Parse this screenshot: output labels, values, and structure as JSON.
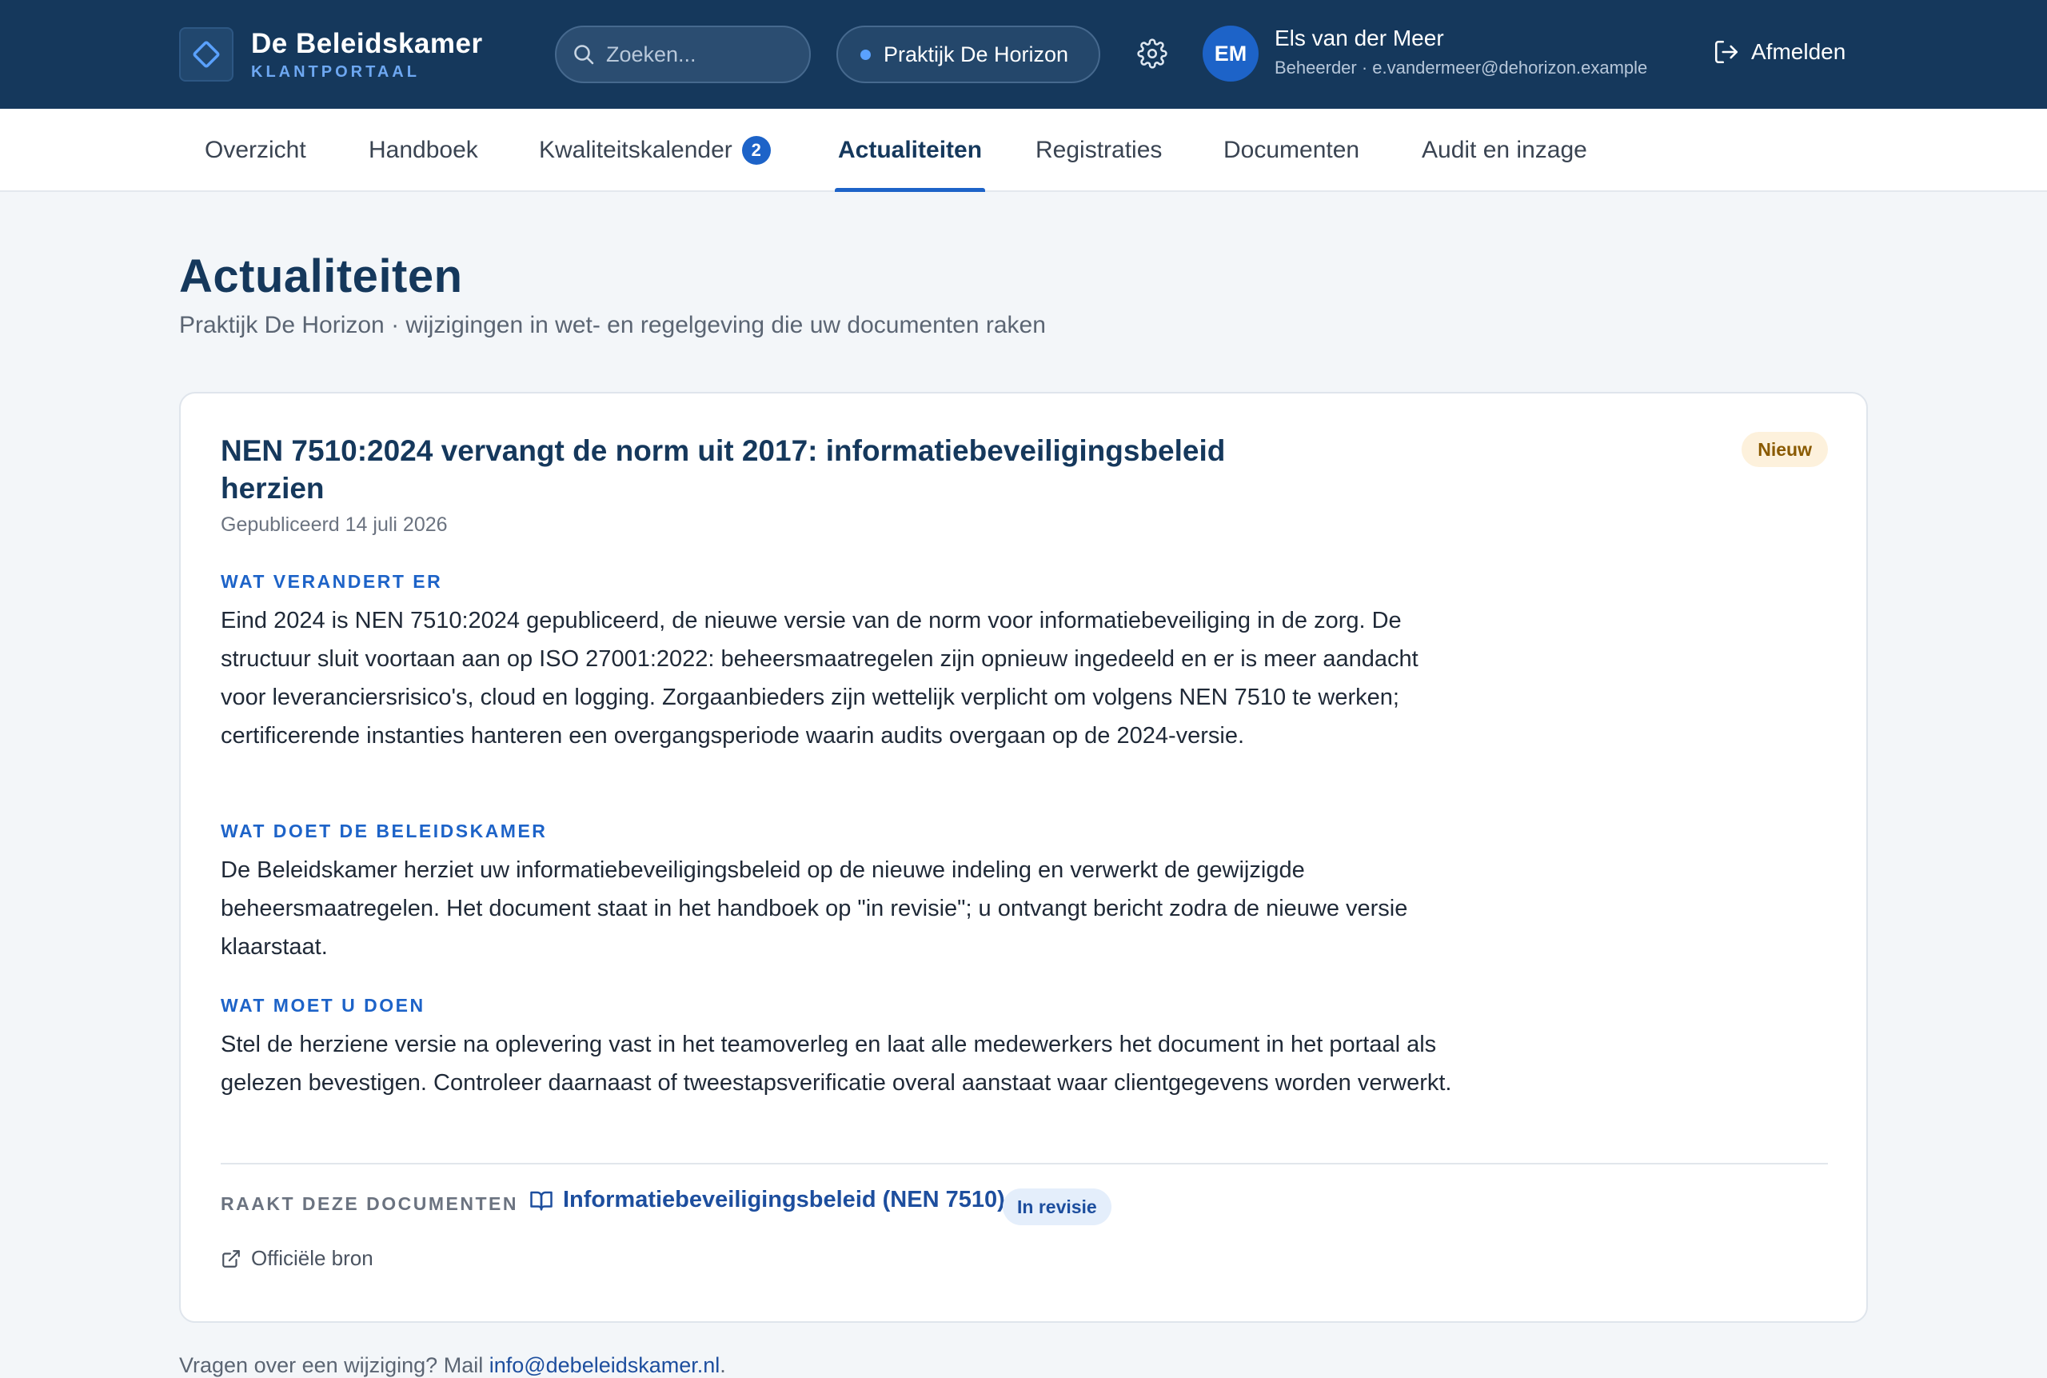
{
  "brand": {
    "name": "De Beleidskamer",
    "subtitle": "KLANTPORTAAL"
  },
  "search": {
    "placeholder": "Zoeken..."
  },
  "practice_selector": {
    "label": "Praktijk De Horizon"
  },
  "user": {
    "initials": "EM",
    "name": "Els van der Meer",
    "meta": "Beheerder · e.vandermeer@dehorizon.example"
  },
  "logout_label": "Afmelden",
  "tabs": [
    {
      "label": "Overzicht"
    },
    {
      "label": "Handboek"
    },
    {
      "label": "Kwaliteitskalender",
      "badge": "2"
    },
    {
      "label": "Actualiteiten",
      "active": true
    },
    {
      "label": "Registraties"
    },
    {
      "label": "Documenten"
    },
    {
      "label": "Audit en inzage"
    }
  ],
  "page": {
    "title": "Actualiteiten",
    "subtitle": "Praktijk De Horizon · wijzigingen in wet- en regelgeving die uw documenten raken"
  },
  "item": {
    "title": "NEN 7510:2024 vervangt de norm uit 2017: informatiebeveiligingsbeleid herzien",
    "status_badge": "Nieuw",
    "published": "Gepubliceerd 14 juli 2026",
    "sections": [
      {
        "label": "WAT VERANDERT ER",
        "text": "Eind 2024 is NEN 7510:2024 gepubliceerd, de nieuwe versie van de norm voor informatiebeveiliging in de zorg. De structuur sluit voortaan aan op ISO 27001:2022: beheersmaatregelen zijn opnieuw ingedeeld en er is meer aandacht voor leveranciersrisico's, cloud en logging. Zorgaanbieders zijn wettelijk verplicht om volgens NEN 7510 te werken; certificerende instanties hanteren een overgangsperiode waarin audits overgaan op de 2024-versie."
      },
      {
        "label": "WAT DOET DE BELEIDSKAMER",
        "text": "De Beleidskamer herziet uw informatiebeveiligingsbeleid op de nieuwe indeling en verwerkt de gewijzigde beheersmaatregelen. Het document staat in het handboek op \"in revisie\"; u ontvangt bericht zodra de nieuwe versie klaarstaat."
      },
      {
        "label": "WAT MOET U DOEN",
        "text": "Stel de herziene versie na oplevering vast in het teamoverleg en laat alle medewerkers het document in het portaal als gelezen bevestigen. Controleer daarnaast of tweestapsverificatie overal aanstaat waar clientgegevens worden verwerkt."
      }
    ],
    "affects_label": "RAAKT DEZE DOCUMENTEN",
    "document_link": "Informatiebeveiligingsbeleid (NEN 7510)",
    "document_status": "In revisie",
    "source_link": "Officiële bron"
  },
  "footer": {
    "text": "Vragen over een wijziging? Mail ",
    "email": "info@debeleidskamer.nl",
    "suffix": "."
  },
  "colors": {
    "header_bg": "#15385c",
    "accent": "#1d63c8",
    "badge_new_bg": "#fdf1dc",
    "badge_new_text": "#8a5a00",
    "badge_revision_bg": "#e4eefb"
  }
}
